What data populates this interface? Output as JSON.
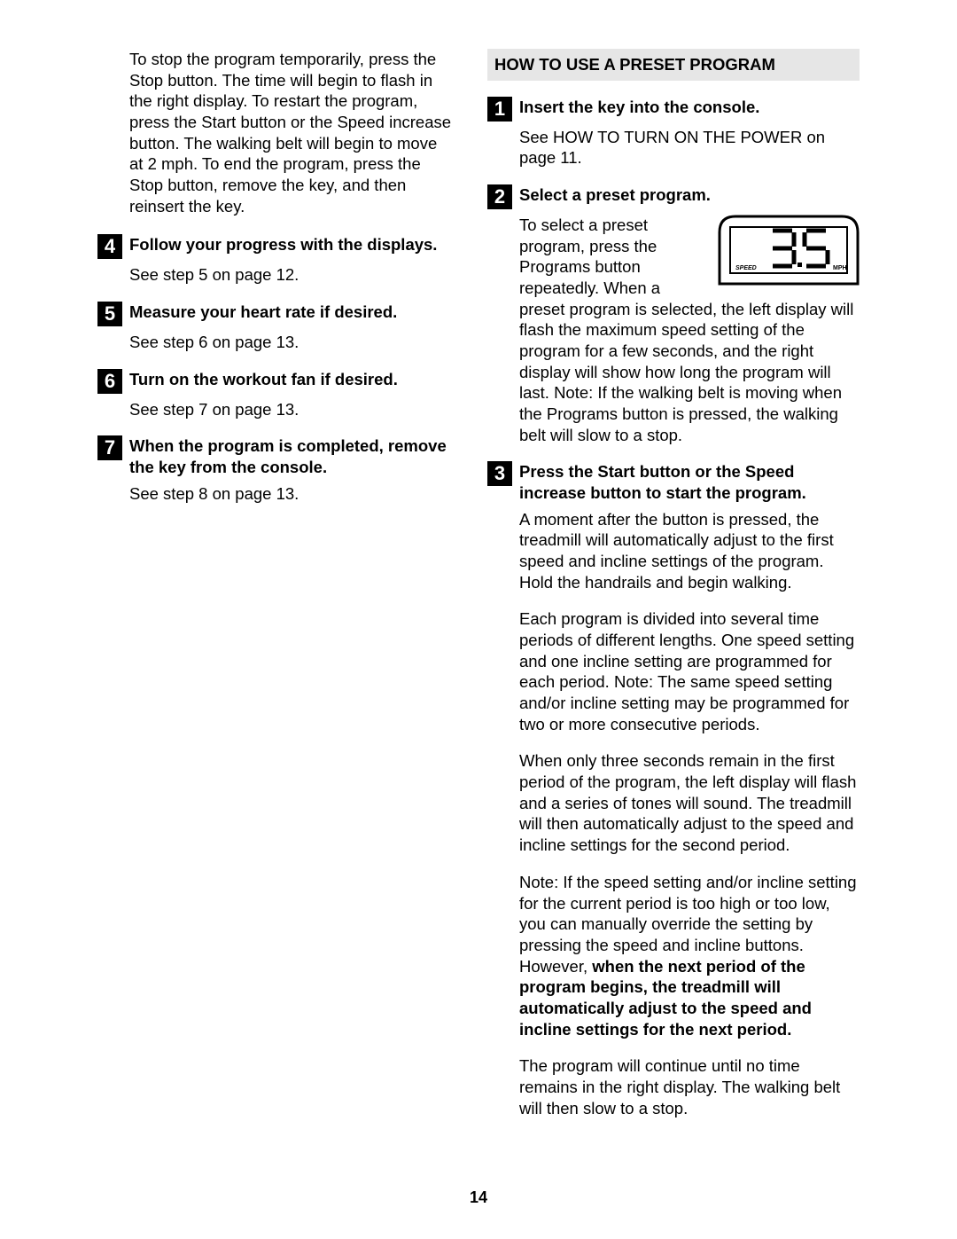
{
  "left": {
    "intro_para": "To stop the program temporarily, press the Stop button. The time will begin to flash in the right display. To restart the program, press the Start button or the Speed increase button. The walking belt will begin to move at 2 mph. To end the program, press the Stop button, remove the key, and then reinsert the key.",
    "steps": [
      {
        "num": "4",
        "head": "Follow your progress with the displays.",
        "body": "See step 5 on page 12."
      },
      {
        "num": "5",
        "head": "Measure your heart rate if desired.",
        "body": "See step 6 on page 13."
      },
      {
        "num": "6",
        "head": "Turn on the workout fan if desired.",
        "body": "See step 7 on page 13."
      },
      {
        "num": "7",
        "head": "When the program is completed, remove the key from the console.",
        "body": "See step 8 on page 13."
      }
    ]
  },
  "right": {
    "section_title": "HOW TO USE A PRESET PROGRAM",
    "step1": {
      "num": "1",
      "head": "Insert the key into the console.",
      "body": "See HOW TO TURN ON THE POWER on page 11."
    },
    "step2": {
      "num": "2",
      "head": "Select a preset program.",
      "display": {
        "speed_label": "SPEED",
        "value": "3.5",
        "unit": "MPH"
      },
      "para_a": "To select a preset program, press the Programs button repeatedly. When a preset program is selected, the left display will flash",
      "para_b": "the maximum speed setting of the program for a few seconds, and the right display will show how long the program will last. Note: If the walking belt is moving when the Programs button is pressed, the walking belt will slow to a stop."
    },
    "step3": {
      "num": "3",
      "head": "Press the Start button or the Speed increase button to start the program.",
      "p1": "A moment after the button is pressed, the treadmill will automatically adjust to the first speed and incline settings of the program. Hold the handrails and begin walking.",
      "p2": "Each program is divided into several time periods of different lengths. One speed setting and one incline setting are programmed for each period. Note: The same speed setting and/or incline setting may be programmed for two or more consecutive periods.",
      "p3": "When only three seconds remain in the first period of the program, the left display will flash and a series of tones will sound. The treadmill will then automatically adjust to the speed and incline settings for the second period.",
      "p4_a": "Note: If the speed setting and/or incline setting for the current period is too high or too low, you can manually override the setting by pressing the speed and incline buttons. However, ",
      "p4_b": "when the next period of the program begins, the treadmill will automatically adjust to the speed and incline settings for the next period.",
      "p5": "The program will continue until no time remains in the right display. The walking belt will then slow to a stop."
    }
  },
  "page_number": "14"
}
